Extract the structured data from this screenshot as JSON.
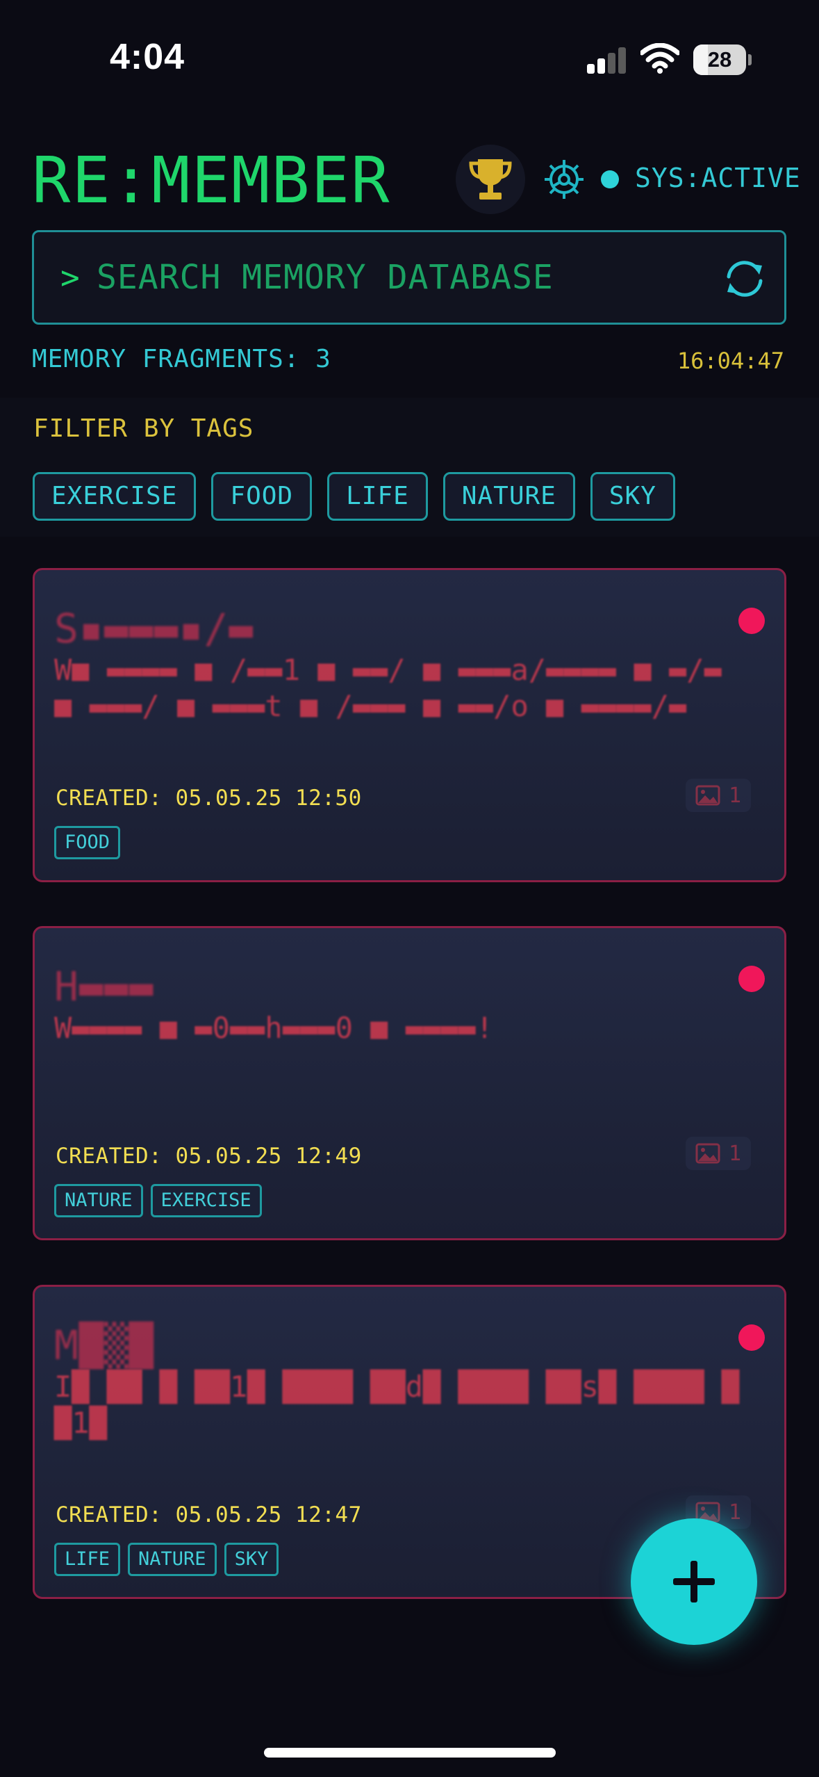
{
  "status_bar": {
    "time": "4:04",
    "battery": "28",
    "battery_level": 0.28
  },
  "header": {
    "title": "RE:MEMBER",
    "system_status": "SYS:ACTIVE",
    "icons": [
      "trophy-icon",
      "gear-icon",
      "status-dot-icon"
    ]
  },
  "search": {
    "prompt": ">",
    "placeholder": "SEARCH MEMORY DATABASE",
    "value": ""
  },
  "summary": {
    "fragments_label": "MEMORY FRAGMENTS: 3",
    "clock": "16:04:47"
  },
  "filter": {
    "label": "FILTER BY TAGS",
    "tags": [
      "EXERCISE",
      "FOOD",
      "LIFE",
      "NATURE",
      "SKY"
    ]
  },
  "memories": [
    {
      "title": "S▪▬▬▬▪/▬",
      "body": "W■ ▬▬▬▬ ■ /▬▬1 ■ ▬▬/ ■ ▬▬▬a/▬▬▬▬ ■ ▬/▬ ■ ▬▬▬/ ■ ▬▬▬t ■ /▬▬▬ ■ ▬▬/o ■ ▬▬▬▬/▬",
      "created": "CREATED: 05.05.25 12:50",
      "image_count": "1",
      "tags": [
        "FOOD"
      ]
    },
    {
      "title": "H▬▬▬",
      "body": "W▬▬▬▬ ■ ▬0▬▬h▬▬▬0 ■ ▬▬▬▬!",
      "created": "CREATED: 05.05.25 12:49",
      "image_count": "1",
      "tags": [
        "NATURE",
        "EXERCISE"
      ]
    },
    {
      "title": "M█▒█",
      "body": "I█ ██ █ ██1█ ████ ██d█ ████ ██s█ ████ ██1█",
      "created": "CREATED: 05.05.25 12:47",
      "image_count": "1",
      "tags": [
        "LIFE",
        "NATURE",
        "SKY"
      ]
    }
  ],
  "fab": {
    "icon": "plus-icon"
  },
  "colors": {
    "background": "#0b0b14",
    "accent_green": "#1fd66b",
    "accent_cyan": "#1cd3d6",
    "accent_yellow": "#f2de52",
    "card_border": "#8b1f45",
    "alert_dot": "#f0175a"
  }
}
